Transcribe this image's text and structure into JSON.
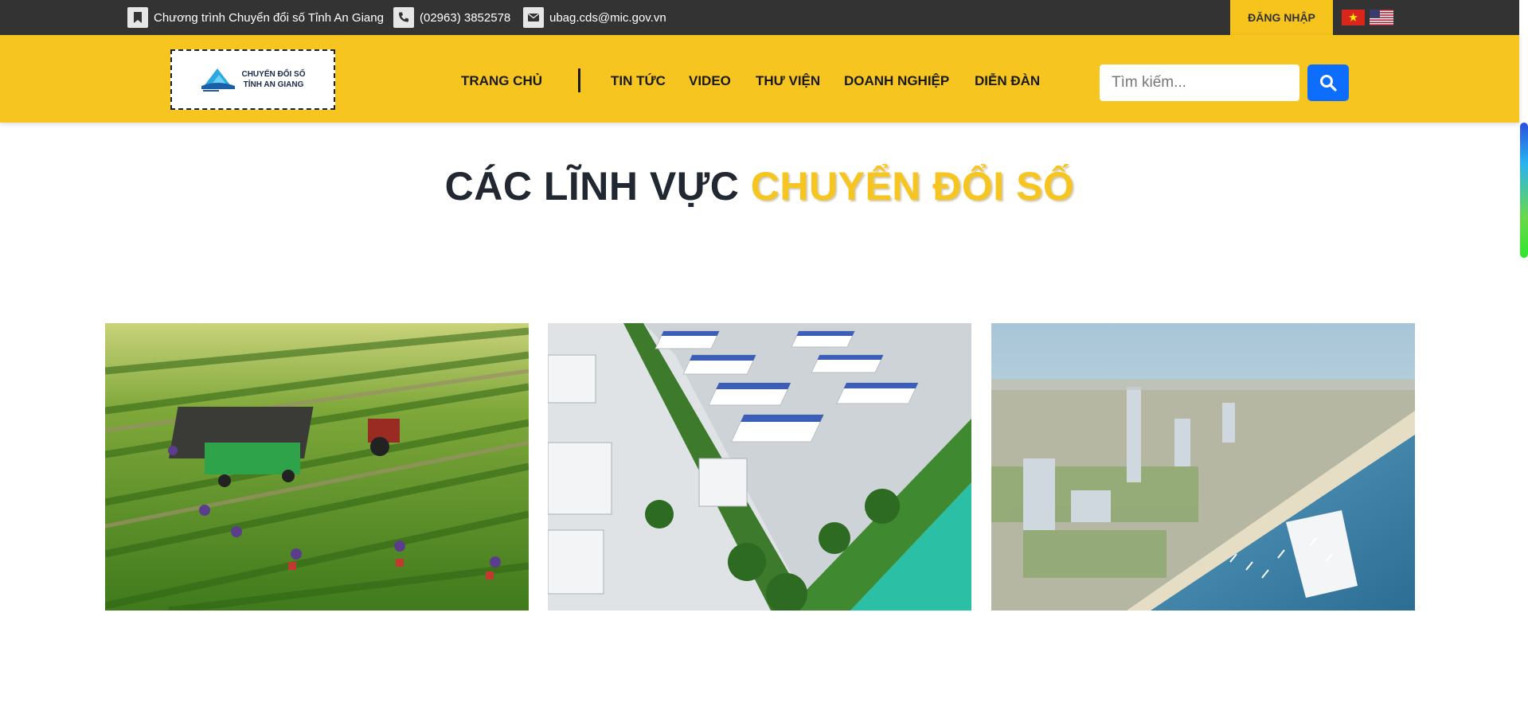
{
  "topbar": {
    "program": "Chương trình Chuyển đổi số Tỉnh An Giang",
    "phone": "(02963) 3852578",
    "email": "ubag.cds@mic.gov.vn",
    "login": "ĐĂNG NHẬP",
    "lang_vi_icon": "vietnam-flag-icon",
    "lang_en_icon": "us-flag-icon"
  },
  "logo": {
    "line1": "CHUYỂN ĐỔI SỐ",
    "line2": "TỈNH AN GIANG"
  },
  "nav": {
    "home": "TRANG CHỦ",
    "news": "TIN TỨC",
    "video": "VIDEO",
    "library": "THƯ VIỆN",
    "business": "DOANH NGHIỆP",
    "forum": "DIỄN ĐÀN"
  },
  "search": {
    "placeholder": "Tìm kiếm...",
    "icon": "search-icon"
  },
  "section": {
    "title_main": "CÁC LĨNH VỰC",
    "title_accent": "CHUYỂN ĐỔI SỐ"
  },
  "cards": [
    {
      "image": "agriculture-field-photo"
    },
    {
      "image": "industrial-park-photo"
    },
    {
      "image": "coastal-city-photo"
    }
  ],
  "colors": {
    "topbar": "#333333",
    "brand_yellow": "#f7c520",
    "search_button": "#0d6efd",
    "title_dark": "#222831"
  }
}
